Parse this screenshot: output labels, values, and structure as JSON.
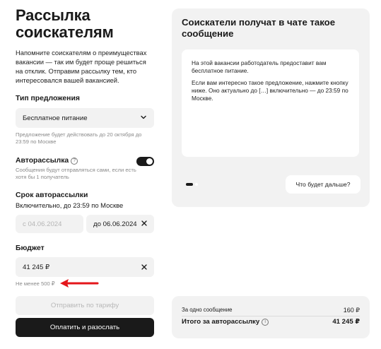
{
  "page": {
    "title_line1": "Рассылка",
    "title_line2": "соискателям",
    "intro": "Напомните соискателям о преимуществах вакансии — так им будет проще решиться на отклик. Отправим рассылку тем, кто интересовался вашей вакансией."
  },
  "offer": {
    "label": "Тип предложения",
    "selected": "Бесплатное питание",
    "hint": "Предложение будет действовать до 20 октября до 23:59 по Москве"
  },
  "auto": {
    "label": "Авторассылка",
    "enabled": true,
    "hint": "Сообщения будут отправляться сами, если есть хотя бы 1 получатель"
  },
  "period": {
    "label": "Срок авторассылки",
    "sublabel": "Включительно, до 23:59 по Москве",
    "from": "с 04.06.2024",
    "to_prefix": "до",
    "to": "06.06.2024"
  },
  "budget": {
    "label": "Бюджет",
    "value": "41 245 ₽",
    "hint": "Не менее 500 ₽"
  },
  "buttons": {
    "tariff": "Отправить по тарифу",
    "pay": "Оплатить и разослать"
  },
  "preview": {
    "title": "Соискатели получат в чате такое сообщение",
    "p1": "На этой вакансии работодатель предоставит вам бесплатное питание.",
    "p2": "Если вам интересно такое предложение, нажмите кнопку ниже. Оно актуально до […] включительно — до 23:59 по Москве.",
    "next": "Что будет дальше?"
  },
  "summary": {
    "per_message_label": "За одно сообщение",
    "per_message_value": "160 ₽",
    "total_label": "Итого за авторассылку",
    "total_value": "41 245 ₽"
  },
  "colors": {
    "accent": "#1a1a1a",
    "annotation_arrow": "#e4161b"
  }
}
